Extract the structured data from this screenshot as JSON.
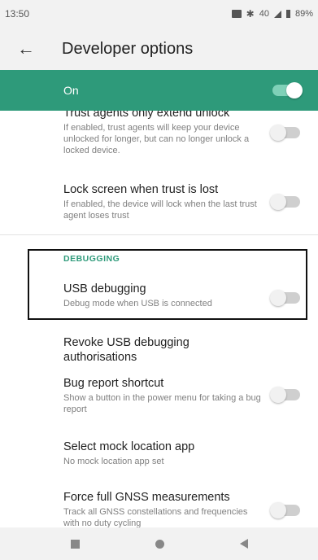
{
  "status_bar": {
    "time": "13:50",
    "battery": "89%",
    "network": "40"
  },
  "header": {
    "title": "Developer options",
    "back_icon": "arrow-back-icon"
  },
  "master_switch": {
    "label": "On",
    "state": "on"
  },
  "colors": {
    "accent": "#2e9a7a",
    "toggle_on_track": "#7fd1b8"
  },
  "preferences": [
    {
      "title": "Trust agents only extend unlock",
      "summary": "If enabled, trust agents will keep your device unlocked for longer, but can no longer unlock a locked device.",
      "toggle": "off"
    },
    {
      "title": "Lock screen when trust is lost",
      "summary": "If enabled, the device will lock when the last trust agent loses trust",
      "toggle": "off"
    }
  ],
  "debugging": {
    "category": "DEBUGGING",
    "items": [
      {
        "title": "USB debugging",
        "summary": "Debug mode when USB is connected",
        "toggle": "off"
      },
      {
        "title": "Revoke USB debugging authorisations"
      },
      {
        "title": "Bug report shortcut",
        "summary": "Show a button in the power menu for taking a bug report",
        "toggle": "off"
      },
      {
        "title": "Select mock location app",
        "summary": "No mock location app set"
      },
      {
        "title": "Force full GNSS measurements",
        "summary": "Track all GNSS constellations and frequencies with no duty cycling",
        "toggle": "off"
      }
    ]
  },
  "nav_bar": {
    "icons": [
      "recents-square-icon",
      "home-circle-icon",
      "back-triangle-icon"
    ]
  }
}
